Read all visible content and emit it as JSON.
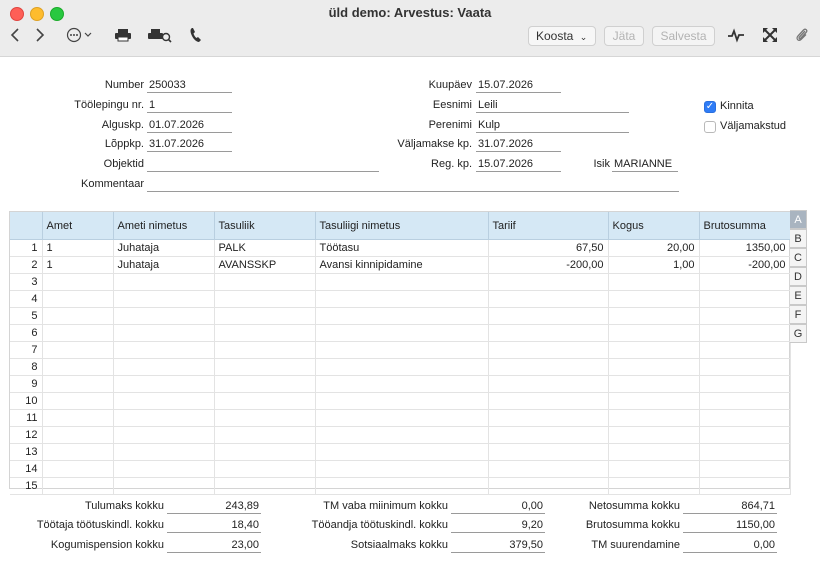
{
  "window": {
    "title": "üld demo: Arvestus: Vaata"
  },
  "toolbar": {
    "koosta_label": "Koosta",
    "jata_label": "Jäta",
    "salvesta_label": "Salvesta"
  },
  "header": {
    "number_label": "Number",
    "number_value": "250033",
    "toolepingu_label": "Töölepingu nr.",
    "toolepingu_value": "1",
    "alguskp_label": "Alguskp.",
    "alguskp_value": "01.07.2026",
    "loppkp_label": "Lõppkp.",
    "loppkp_value": "31.07.2026",
    "objektid_label": "Objektid",
    "objektid_value": "",
    "kommentaar_label": "Kommentaar",
    "kommentaar_value": "",
    "kuupaev_label": "Kuupäev",
    "kuupaev_value": "15.07.2026",
    "eesnimi_label": "Eesnimi",
    "eesnimi_value": "Leili",
    "perenimi_label": "Perenimi",
    "perenimi_value": "Kulp",
    "valjamakse_label": "Väljamakse kp.",
    "valjamakse_value": "31.07.2026",
    "regkp_label": "Reg. kp.",
    "regkp_value": "15.07.2026",
    "isik_label": "Isik",
    "isik_value": "MARIANNE",
    "kinnita_label": "Kinnita",
    "kinnita_checked": true,
    "valjamakstud_label": "Väljamakstud",
    "valjamakstud_checked": false
  },
  "grid": {
    "columns": [
      "Amet",
      "Ameti nimetus",
      "Tasuliik",
      "Tasuliigi nimetus",
      "Tariif",
      "Kogus",
      "Brutosumma"
    ],
    "rows": [
      {
        "n": "1",
        "amet": "1",
        "ameti_nimetus": "Juhataja",
        "tasuliik": "PALK",
        "tasuliigi_nimetus": "Töötasu",
        "tariif": "67,50",
        "kogus": "20,00",
        "brutosumma": "1350,00"
      },
      {
        "n": "2",
        "amet": "1",
        "ameti_nimetus": "Juhataja",
        "tasuliik": "AVANSSKP",
        "tasuliigi_nimetus": "Avansi kinnipidamine",
        "tariif": "-200,00",
        "kogus": "1,00",
        "brutosumma": "-200,00"
      },
      {
        "n": "3",
        "amet": "",
        "ameti_nimetus": "",
        "tasuliik": "",
        "tasuliigi_nimetus": "",
        "tariif": "",
        "kogus": "",
        "brutosumma": ""
      },
      {
        "n": "4",
        "amet": "",
        "ameti_nimetus": "",
        "tasuliik": "",
        "tasuliigi_nimetus": "",
        "tariif": "",
        "kogus": "",
        "brutosumma": ""
      },
      {
        "n": "5",
        "amet": "",
        "ameti_nimetus": "",
        "tasuliik": "",
        "tasuliigi_nimetus": "",
        "tariif": "",
        "kogus": "",
        "brutosumma": ""
      },
      {
        "n": "6",
        "amet": "",
        "ameti_nimetus": "",
        "tasuliik": "",
        "tasuliigi_nimetus": "",
        "tariif": "",
        "kogus": "",
        "brutosumma": ""
      },
      {
        "n": "7",
        "amet": "",
        "ameti_nimetus": "",
        "tasuliik": "",
        "tasuliigi_nimetus": "",
        "tariif": "",
        "kogus": "",
        "brutosumma": ""
      },
      {
        "n": "8",
        "amet": "",
        "ameti_nimetus": "",
        "tasuliik": "",
        "tasuliigi_nimetus": "",
        "tariif": "",
        "kogus": "",
        "brutosumma": ""
      },
      {
        "n": "9",
        "amet": "",
        "ameti_nimetus": "",
        "tasuliik": "",
        "tasuliigi_nimetus": "",
        "tariif": "",
        "kogus": "",
        "brutosumma": ""
      },
      {
        "n": "10",
        "amet": "",
        "ameti_nimetus": "",
        "tasuliik": "",
        "tasuliigi_nimetus": "",
        "tariif": "",
        "kogus": "",
        "brutosumma": ""
      },
      {
        "n": "11",
        "amet": "",
        "ameti_nimetus": "",
        "tasuliik": "",
        "tasuliigi_nimetus": "",
        "tariif": "",
        "kogus": "",
        "brutosumma": ""
      },
      {
        "n": "12",
        "amet": "",
        "ameti_nimetus": "",
        "tasuliik": "",
        "tasuliigi_nimetus": "",
        "tariif": "",
        "kogus": "",
        "brutosumma": ""
      },
      {
        "n": "13",
        "amet": "",
        "ameti_nimetus": "",
        "tasuliik": "",
        "tasuliigi_nimetus": "",
        "tariif": "",
        "kogus": "",
        "brutosumma": ""
      },
      {
        "n": "14",
        "amet": "",
        "ameti_nimetus": "",
        "tasuliik": "",
        "tasuliigi_nimetus": "",
        "tariif": "",
        "kogus": "",
        "brutosumma": ""
      },
      {
        "n": "15",
        "amet": "",
        "ameti_nimetus": "",
        "tasuliik": "",
        "tasuliigi_nimetus": "",
        "tariif": "",
        "kogus": "",
        "brutosumma": ""
      }
    ]
  },
  "tabs": [
    "A",
    "B",
    "C",
    "D",
    "E",
    "F",
    "G"
  ],
  "totals": {
    "tulumaks_label": "Tulumaks kokku",
    "tulumaks_value": "243,89",
    "tootaja_label": "Töötaja töötuskindl. kokku",
    "tootaja_value": "18,40",
    "kogumis_label": "Kogumispension kokku",
    "kogumis_value": "23,00",
    "tmvaba_label": "TM vaba miinimum kokku",
    "tmvaba_value": "0,00",
    "tooandja_label": "Tööandja töötuskindl. kokku",
    "tooandja_value": "9,20",
    "sots_label": "Sotsiaalmaks kokku",
    "sots_value": "379,50",
    "neto_label": "Netosumma kokku",
    "neto_value": "864,71",
    "bruto_label": "Brutosumma kokku",
    "bruto_value": "1150,00",
    "tmsuur_label": "TM suurendamine",
    "tmsuur_value": "0,00"
  },
  "icons": {
    "back": "chevron-left-icon",
    "forward": "chevron-right-icon",
    "more": "ellipsis-icon",
    "print": "printer-icon",
    "print_preview": "print-preview-icon",
    "phone": "phone-icon",
    "activity": "activity-icon",
    "expand": "expand-icon",
    "attach": "paperclip-icon"
  }
}
